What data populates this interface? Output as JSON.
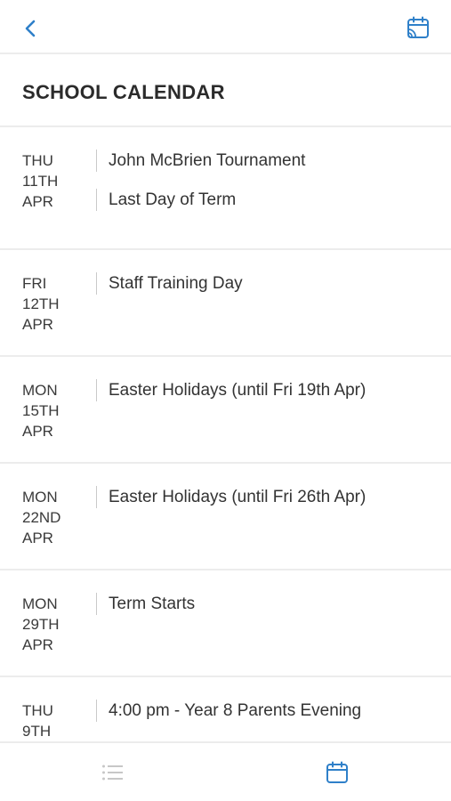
{
  "header": {
    "back_icon": "chevron-left-icon",
    "action_icon": "calendar-cast-icon",
    "accent_color": "#2f80c9"
  },
  "page": {
    "title": "SCHOOL CALENDAR"
  },
  "days": [
    {
      "weekday": "THU",
      "date": "11TH",
      "month": "APR",
      "events": [
        "John McBrien Tournament",
        "Last Day of Term"
      ]
    },
    {
      "weekday": "FRI",
      "date": "12TH",
      "month": "APR",
      "events": [
        "Staff Training Day"
      ]
    },
    {
      "weekday": "MON",
      "date": "15TH",
      "month": "APR",
      "events": [
        "Easter Holidays (until Fri 19th Apr)"
      ]
    },
    {
      "weekday": "MON",
      "date": "22ND",
      "month": "APR",
      "events": [
        "Easter Holidays (until Fri 26th Apr)"
      ]
    },
    {
      "weekday": "MON",
      "date": "29TH",
      "month": "APR",
      "events": [
        "Term Starts"
      ]
    },
    {
      "weekday": "THU",
      "date": "9TH",
      "month": "",
      "events": [
        "4:00 pm - Year 8 Parents Evening"
      ]
    }
  ],
  "bottom_nav": {
    "list_icon": "list-icon",
    "calendar_icon": "calendar-icon",
    "active_tab": "calendar",
    "inactive_color": "#c7c7c7",
    "active_color": "#2f80c9"
  }
}
